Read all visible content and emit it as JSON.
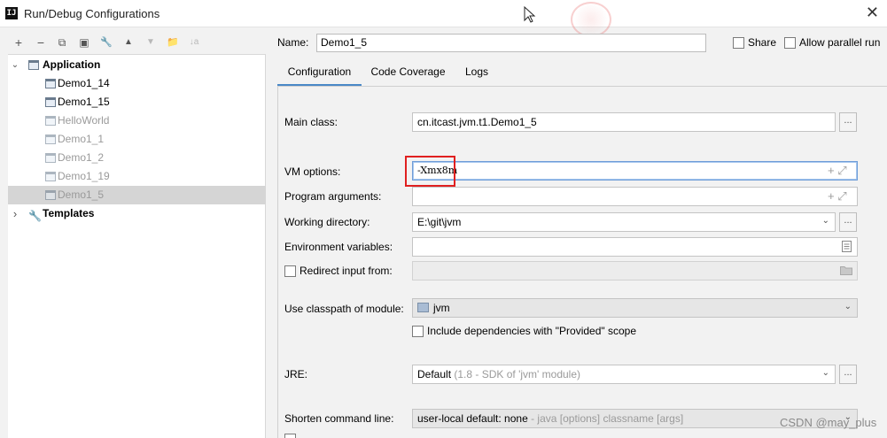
{
  "window": {
    "title": "Run/Debug Configurations",
    "app_icon_text": "IJ",
    "close_symbol": "✕"
  },
  "toolbar": {
    "add": "+",
    "remove": "−",
    "copy": "⧉",
    "save": "▣",
    "edit_defaults": "🔧",
    "move_up": "▲",
    "move_down": "▼",
    "folder": "📁",
    "sort": "↓a"
  },
  "tree": {
    "application": {
      "label": "Application",
      "chevron": "⌄"
    },
    "items": [
      {
        "label": "Demo1_14",
        "faded": false
      },
      {
        "label": "Demo1_15",
        "faded": false
      },
      {
        "label": "HelloWorld",
        "faded": true
      },
      {
        "label": "Demo1_1",
        "faded": true
      },
      {
        "label": "Demo1_2",
        "faded": true
      },
      {
        "label": "Demo1_19",
        "faded": true
      },
      {
        "label": "Demo1_5",
        "faded": true,
        "selected": true
      }
    ],
    "templates": {
      "label": "Templates",
      "chevron": "›"
    }
  },
  "header": {
    "name_label": "Name:",
    "name_value": "Demo1_5",
    "share_label": "Share",
    "parallel_label": "Allow parallel run"
  },
  "tabs": [
    "Configuration",
    "Code Coverage",
    "Logs"
  ],
  "form": {
    "main_class_label": "Main class:",
    "main_class_value": "cn.itcast.jvm.t1.Demo1_5",
    "vm_options_label": "VM options:",
    "vm_options_value": "-Xmx8m",
    "program_args_label": "Program arguments:",
    "program_args_value": "",
    "working_dir_label": "Working directory:",
    "working_dir_value": "E:\\git\\jvm",
    "env_vars_label": "Environment variables:",
    "env_vars_value": "",
    "redirect_label": "Redirect input from:",
    "classpath_label": "Use classpath of module:",
    "classpath_value": "jvm",
    "include_deps_label": "Include dependencies with \"Provided\" scope",
    "jre_label": "JRE:",
    "jre_value": "Default",
    "jre_hint": "(1.8 - SDK of 'jvm' module)",
    "shorten_label": "Shorten command line:",
    "shorten_value": "user-local default: none",
    "shorten_hint": "- java [options] classname [args]",
    "dots": "...",
    "expand_icons": "+ ⤢",
    "dropdown_arrow": "⌄"
  },
  "watermark": "CSDN @may_plus",
  "colors": {
    "accent": "#4a88c7",
    "highlight_box": "#e02020",
    "selection": "#d5d5d5"
  }
}
